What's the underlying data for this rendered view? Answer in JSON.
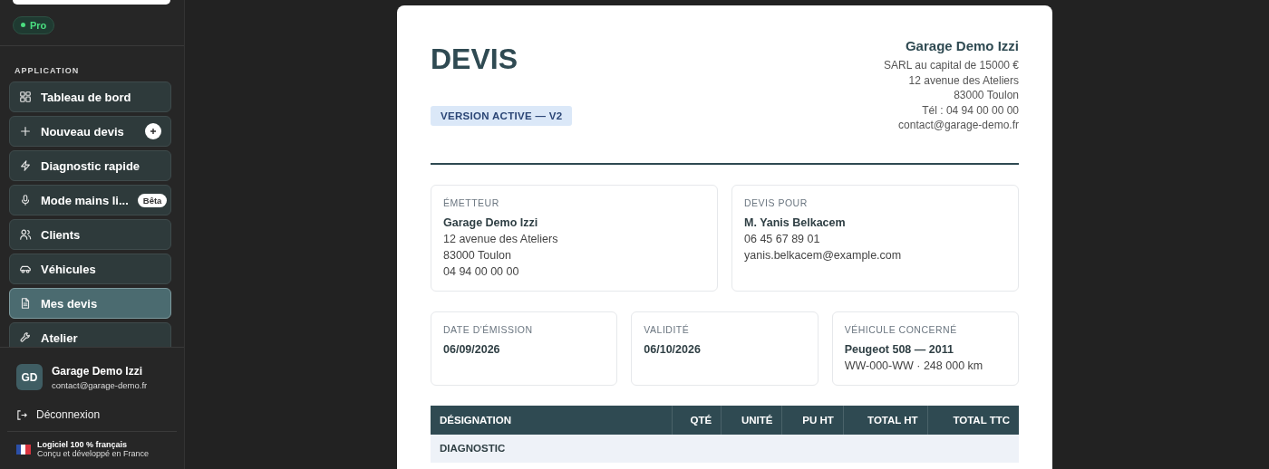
{
  "sidebar": {
    "plan_badge": "Pro",
    "section_label": "APPLICATION",
    "nav_items": [
      {
        "label": "Tableau de bord",
        "selected": false,
        "plus_button": false
      },
      {
        "label": "Nouveau devis",
        "selected": false,
        "plus_button": true
      },
      {
        "label": "Diagnostic rapide",
        "selected": false,
        "plus_button": false
      },
      {
        "label": "Mode mains li...",
        "selected": false,
        "plus_button": false,
        "badge": "Bêta"
      },
      {
        "label": "Clients",
        "selected": false,
        "plus_button": false
      },
      {
        "label": "Véhicules",
        "selected": false,
        "plus_button": false
      },
      {
        "label": "Mes devis",
        "selected": true,
        "plus_button": false
      },
      {
        "label": "Atelier",
        "selected": false,
        "plus_button": false
      }
    ],
    "account": {
      "initials": "GD",
      "name": "Garage Demo Izzi",
      "email": "contact@garage-demo.fr"
    },
    "logout": "Déconnexion",
    "footer_notice": {
      "title": "Logiciel 100 % français",
      "subtitle": "Conçu et développé en France"
    }
  },
  "document": {
    "title": "DEVIS",
    "version_badge": "VERSION ACTIVE — V2",
    "company": {
      "name": "Garage Demo Izzi",
      "lines": [
        "SARL au capital de 15000 €",
        "12 avenue des Ateliers",
        "83000 Toulon",
        "Tél : 04 94 00 00 00",
        "contact@garage-demo.fr"
      ]
    },
    "parties": [
      {
        "label": "ÉMETTEUR",
        "name": "Garage Demo Izzi",
        "lines": [
          "12 avenue des Ateliers",
          "83000 Toulon",
          "04 94 00 00 00"
        ]
      },
      {
        "label": "DEVIS POUR",
        "name": "M. Yanis Belkacem",
        "lines": [
          "06 45 67 89 01",
          "yanis.belkacem@example.com"
        ]
      }
    ],
    "details": [
      {
        "label": "DATE D'ÉMISSION",
        "value": "06/09/2026"
      },
      {
        "label": "VALIDITÉ",
        "value": "06/10/2026"
      },
      {
        "label": "VÉHICULE CONCERNÉ",
        "value": "Peugeot 508 — 2011",
        "note": "WW-000-WW · 248 000 km"
      }
    ],
    "table": {
      "columns": [
        "DÉSIGNATION",
        "QTÉ",
        "UNITÉ",
        "PU HT",
        "TOTAL HT",
        "TOTAL TTC"
      ],
      "sections": [
        "DIAGNOSTIC"
      ]
    }
  }
}
